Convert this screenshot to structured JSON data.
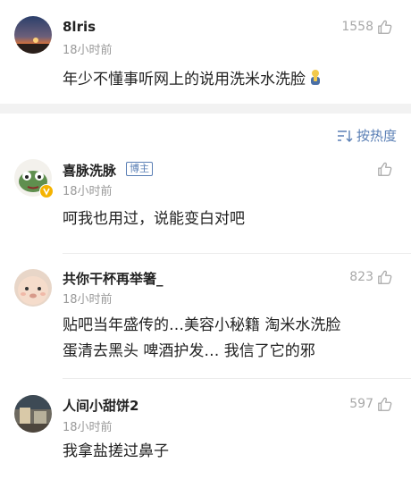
{
  "top_comment": {
    "username": "8lris",
    "time": "18小时前",
    "likes": "1558",
    "text": "年少不懂事听网上的说用洗米水洗脸",
    "emoji": "praying-figure"
  },
  "sort": {
    "label": "按热度"
  },
  "comments": [
    {
      "username": "喜脉洗脉",
      "badge": "博主",
      "time": "18小时前",
      "likes": "",
      "text": "呵我也用过，说能变白对吧"
    },
    {
      "username": "共你干杯再举箸_",
      "time": "18小时前",
      "likes": "823",
      "text_line1": "贴吧当年盛传的…美容小秘籍 淘米水洗脸",
      "text_line2": "蛋清去黑头 啤酒护发… 我信了它的邪"
    },
    {
      "username": "人间小甜饼2",
      "time": "18小时前",
      "likes": "597",
      "text": "我拿盐搓过鼻子"
    }
  ],
  "colors": {
    "accent": "#5a7fb5",
    "muted": "#9a9a9a",
    "band": "#f2f2f2"
  }
}
